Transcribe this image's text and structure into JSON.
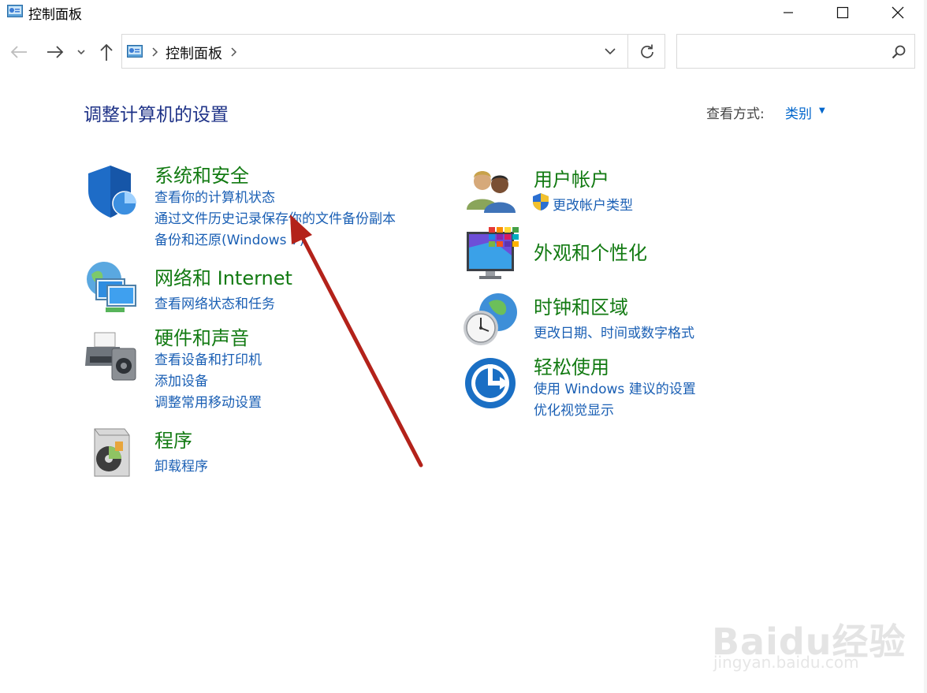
{
  "window": {
    "title": "控制面板",
    "controls": [
      "minimize",
      "maximize",
      "close"
    ]
  },
  "navigation": {
    "breadcrumbs": [
      "控制面板"
    ],
    "search": {
      "placeholder": "",
      "value": ""
    }
  },
  "header": {
    "title": "调整计算机的设置",
    "view_by_label": "查看方式:",
    "view_by_value": "类别"
  },
  "categories": {
    "system_security": {
      "title": "系统和安全",
      "links": [
        "查看你的计算机状态",
        "通过文件历史记录保存你的文件备份副本",
        "备份和还原(Windows 7)"
      ]
    },
    "network": {
      "title": "网络和 Internet",
      "links": [
        "查看网络状态和任务"
      ]
    },
    "hardware": {
      "title": "硬件和声音",
      "links": [
        "查看设备和打印机",
        "添加设备",
        "调整常用移动设置"
      ]
    },
    "programs": {
      "title": "程序",
      "links": [
        "卸载程序"
      ]
    },
    "user_accounts": {
      "title": "用户帐户",
      "links": [
        "更改帐户类型"
      ]
    },
    "appearance": {
      "title": "外观和个性化",
      "links": []
    },
    "clock_region": {
      "title": "时钟和区域",
      "links": [
        "更改日期、时间或数字格式"
      ]
    },
    "ease_of_access": {
      "title": "轻松使用",
      "links": [
        "使用 Windows 建议的设置",
        "优化视觉显示"
      ]
    }
  },
  "watermark": {
    "logo": "Baidu经验",
    "url": "jingyan.baidu.com"
  },
  "colors": {
    "category_title": "#127a12",
    "link": "#1a5fb4",
    "page_title": "#1e3287",
    "annotation_arrow": "#b3221a"
  }
}
